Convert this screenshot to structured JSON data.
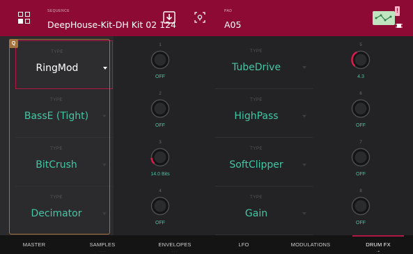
{
  "header": {
    "sequence_caption": "SEQUENCE",
    "sequence_name": "DeepHouse-Kit-DH Kit 02 124",
    "pad_caption": "PAD",
    "pad_name": "A05"
  },
  "left_column": {
    "badge": "Q",
    "type_caption": "TYPE",
    "cells": [
      {
        "type": "TYPE",
        "value": "RingMod"
      },
      {
        "type": "TYPE",
        "value": "BassE (Tight)"
      },
      {
        "type": "TYPE",
        "value": "BitCrush"
      },
      {
        "type": "TYPE",
        "value": "Decimator"
      }
    ]
  },
  "left_knobs": [
    {
      "number": "1",
      "value": "OFF",
      "level": 0
    },
    {
      "number": "2",
      "value": "OFF",
      "level": 0
    },
    {
      "number": "3",
      "value": "14.0 Bits",
      "level": 0.15
    },
    {
      "number": "4",
      "value": "OFF",
      "level": 0
    }
  ],
  "right_column": {
    "cells": [
      {
        "type": "TYPE",
        "value": "TubeDrive"
      },
      {
        "type": "TYPE",
        "value": "HighPass"
      },
      {
        "type": "TYPE",
        "value": "SoftClipper"
      },
      {
        "type": "TYPE",
        "value": "Gain"
      }
    ]
  },
  "right_knobs": [
    {
      "number": "5",
      "value": "4.3",
      "level": 0.4
    },
    {
      "number": "6",
      "value": "OFF",
      "level": 0
    },
    {
      "number": "7",
      "value": "OFF",
      "level": 0
    },
    {
      "number": "8",
      "value": "OFF",
      "level": 0
    }
  ],
  "tabs": [
    {
      "label": "MASTER",
      "dots": "",
      "active": false
    },
    {
      "label": "SAMPLES",
      "dots": "····",
      "active": false
    },
    {
      "label": "ENVELOPES",
      "dots": "···",
      "active": false
    },
    {
      "label": "LFO",
      "dots": "",
      "active": false
    },
    {
      "label": "MODULATIONS",
      "dots": "",
      "active": false
    },
    {
      "label": "DRUM FX",
      "dots": "·•",
      "active": true
    }
  ],
  "colors": {
    "header_bg": "#8c0a34",
    "accent": "#b11845",
    "value_text": "#43c7a4",
    "knob_indicator": "#e01a4f"
  }
}
